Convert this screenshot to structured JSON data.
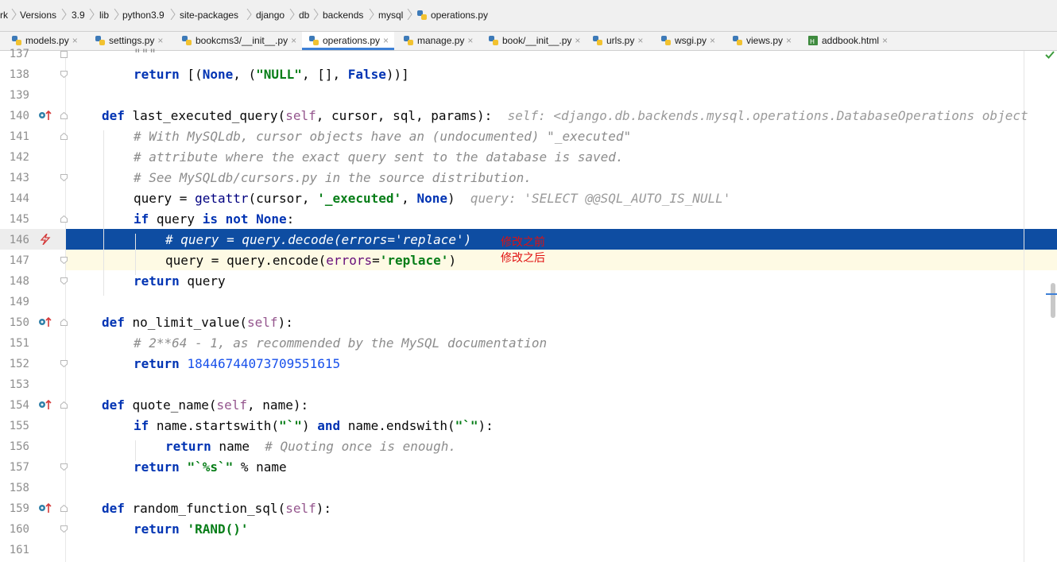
{
  "breadcrumb": {
    "items": [
      "rk",
      "Versions",
      "3.9",
      "lib",
      "python3.9",
      "site-packages",
      "django",
      "db",
      "backends",
      "mysql",
      "operations.py"
    ]
  },
  "tabs": [
    {
      "label": "models.py",
      "active": false
    },
    {
      "label": "settings.py",
      "active": false
    },
    {
      "label": "bookcms3/__init__.py",
      "active": false
    },
    {
      "label": "operations.py",
      "active": true
    },
    {
      "label": "manage.py",
      "active": false
    },
    {
      "label": "book/__init__.py",
      "active": false
    },
    {
      "label": "urls.py",
      "active": false
    },
    {
      "label": "wsgi.py",
      "active": false
    },
    {
      "label": "views.py",
      "active": false
    },
    {
      "label": "addbook.html",
      "active": false
    }
  ],
  "tab_close_glyph": "×",
  "line_numbers": [
    "137",
    "138",
    "139",
    "140",
    "141",
    "142",
    "143",
    "144",
    "145",
    "146",
    "147",
    "148",
    "149",
    "150",
    "151",
    "152",
    "153",
    "154",
    "155",
    "156",
    "157",
    "158",
    "159",
    "160",
    "161"
  ],
  "code": {
    "l137": "\"\"\"",
    "l138": [
      "return",
      " [(",
      "None",
      ", (",
      "\"NULL\"",
      ", [], ",
      "False",
      "))]"
    ],
    "l140": [
      "def",
      " last_executed_query(",
      "self",
      ", cursor, sql, params):  ",
      "self: <django.db.backends.mysql.operations.DatabaseOperations object"
    ],
    "l141": "# With MySQLdb, cursor objects have an (undocumented) \"_executed\"",
    "l142": "# attribute where the exact query sent to the database is saved.",
    "l143": "# See MySQLdb/cursors.py in the source distribution.",
    "l144": [
      "query = ",
      "getattr",
      "(cursor, ",
      "'_executed'",
      ", ",
      "None",
      ")  ",
      "query: 'SELECT @@SQL_AUTO_IS_NULL'"
    ],
    "l145": [
      "if",
      " query ",
      "is not",
      " ",
      "None",
      ":"
    ],
    "l146": "# query = query.decode(errors='replace')",
    "l147": [
      "query = query.encode(",
      "errors",
      "=",
      "'replace'",
      ")"
    ],
    "l148": [
      "return",
      " query"
    ],
    "l150": [
      "def",
      " no_limit_value(",
      "self",
      "):"
    ],
    "l151": "# 2**64 - 1, as recommended by the MySQL documentation",
    "l152": [
      "return",
      " ",
      "18446744073709551615"
    ],
    "l154": [
      "def",
      " quote_name(",
      "self",
      ", name):"
    ],
    "l155": [
      "if",
      " name.startswith(",
      "\"`\"",
      ") ",
      "and",
      " name.endswith(",
      "\"`\"",
      "):"
    ],
    "l156": [
      "return",
      " name  ",
      "# Quoting once is enough."
    ],
    "l157": [
      "return",
      " ",
      "\"`%s`\"",
      " % name"
    ],
    "l159": [
      "def",
      " random_function_sql(",
      "self",
      "):"
    ],
    "l160": [
      "return",
      " ",
      "'RAND()'"
    ]
  },
  "annotations": {
    "before": "修改之前",
    "after": "修改之后"
  },
  "colors": {
    "keyword": "#0033b3",
    "string": "#067d17",
    "comment": "#8c8c8c",
    "selection": "#0e4da2",
    "annotation": "#e01010"
  }
}
